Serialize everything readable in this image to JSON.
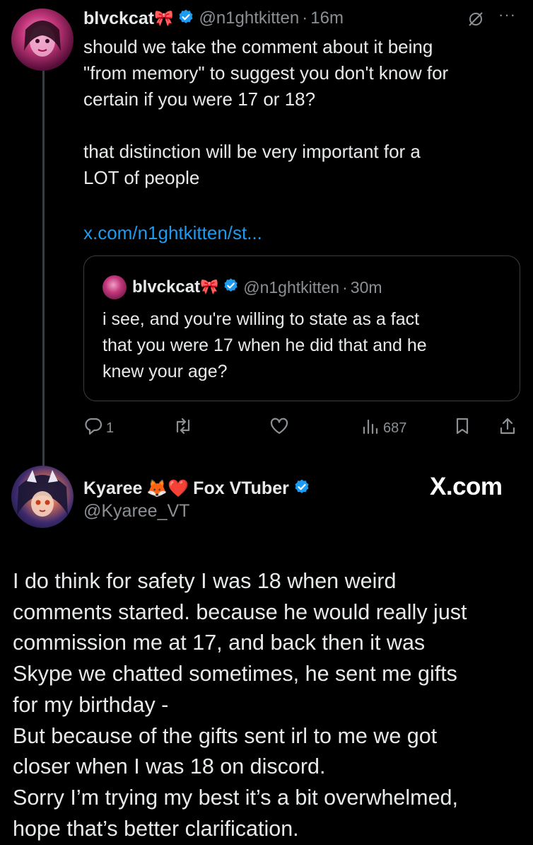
{
  "tweet": {
    "display_name": "blvckcat",
    "name_emoji": "🎀",
    "handle": "@n1ghtkitten",
    "separator": "·",
    "time": "16m",
    "text": "should we take the comment about it being\n\"from memory\" to suggest you don't know for\ncertain if you were 17 or 18?\n\nthat distinction will be very important for a\nLOT of people",
    "link": "x.com/n1ghtkitten/st..."
  },
  "quote": {
    "display_name": "blvckcat",
    "name_emoji": "🎀",
    "handle": "@n1ghtkitten",
    "separator": "·",
    "time": "30m",
    "text": "i see, and you're willing to state as a fact\nthat you were 17 when he did that and he\nknew your age?"
  },
  "actions": {
    "reply_count": "1",
    "views": "687"
  },
  "reply": {
    "display_name": "Kyaree",
    "emojis": "🦊❤️",
    "name_suffix": "Fox VTuber",
    "handle": "@Kyaree_VT",
    "watermark": "X.com",
    "text": "I do think for safety I was 18 when weird\ncomments started. because he would really just\ncommission me at 17, and back then it was\nSkype we chatted sometimes, he sent me gifts\nfor my birthday -\nBut because of the gifts sent irl to me we got\ncloser when I was 18 on discord.\nSorry I’m trying my best it’s a bit overwhelmed,\nhope that’s better clarification."
  },
  "colors": {
    "background": "#000000",
    "text": "#e7e9ea",
    "muted": "#8b9095",
    "link": "#1d9bf0",
    "verified": "#1d9bf0",
    "border": "#3a3d40"
  },
  "icons": [
    "verified-badge-icon",
    "grok-icon",
    "more-icon",
    "reply-icon",
    "retweet-icon",
    "like-icon",
    "views-icon",
    "bookmark-icon",
    "share-icon"
  ]
}
